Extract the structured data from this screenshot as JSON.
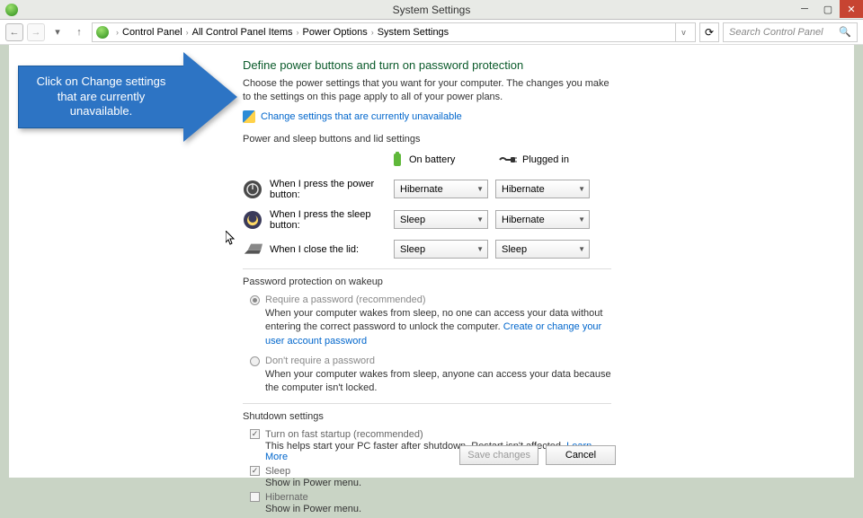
{
  "titlebar": {
    "title": "System Settings"
  },
  "breadcrumb": {
    "items": [
      "Control Panel",
      "All Control Panel Items",
      "Power Options",
      "System Settings"
    ]
  },
  "search": {
    "placeholder": "Search Control Panel"
  },
  "callout": {
    "text": "Click on Change settings that are currently unavailable."
  },
  "main": {
    "heading": "Define power buttons and turn on password protection",
    "sub": "Choose the power settings that you want for your computer. The changes you make to the settings on this page apply to all of your power plans.",
    "change_link": "Change settings that are currently unavailable",
    "section1_title": "Power and sleep buttons and lid settings",
    "col_battery": "On battery",
    "col_plugged": "Plugged in",
    "rows": [
      {
        "label": "When I press the power button:",
        "battery": "Hibernate",
        "plugged": "Hibernate"
      },
      {
        "label": "When I press the sleep button:",
        "battery": "Sleep",
        "plugged": "Hibernate"
      },
      {
        "label": "When I close the lid:",
        "battery": "Sleep",
        "plugged": "Sleep"
      }
    ],
    "section2_title": "Password protection on wakeup",
    "radio1": {
      "label": "Require a password (recommended)",
      "desc": "When your computer wakes from sleep, no one can access your data without entering the correct password to unlock the computer. ",
      "link": "Create or change your user account password"
    },
    "radio2": {
      "label": "Don't require a password",
      "desc": "When your computer wakes from sleep, anyone can access your data because the computer isn't locked."
    },
    "section3_title": "Shutdown settings",
    "chk_fast": {
      "label": "Turn on fast startup (recommended)",
      "desc": "This helps start your PC faster after shutdown. Restart isn't affected. ",
      "link": "Learn More"
    },
    "chk_sleep": {
      "label": "Sleep",
      "desc": "Show in Power menu."
    },
    "chk_hibernate": {
      "label": "Hibernate",
      "desc": "Show in Power menu."
    }
  },
  "footer": {
    "save": "Save changes",
    "cancel": "Cancel"
  }
}
